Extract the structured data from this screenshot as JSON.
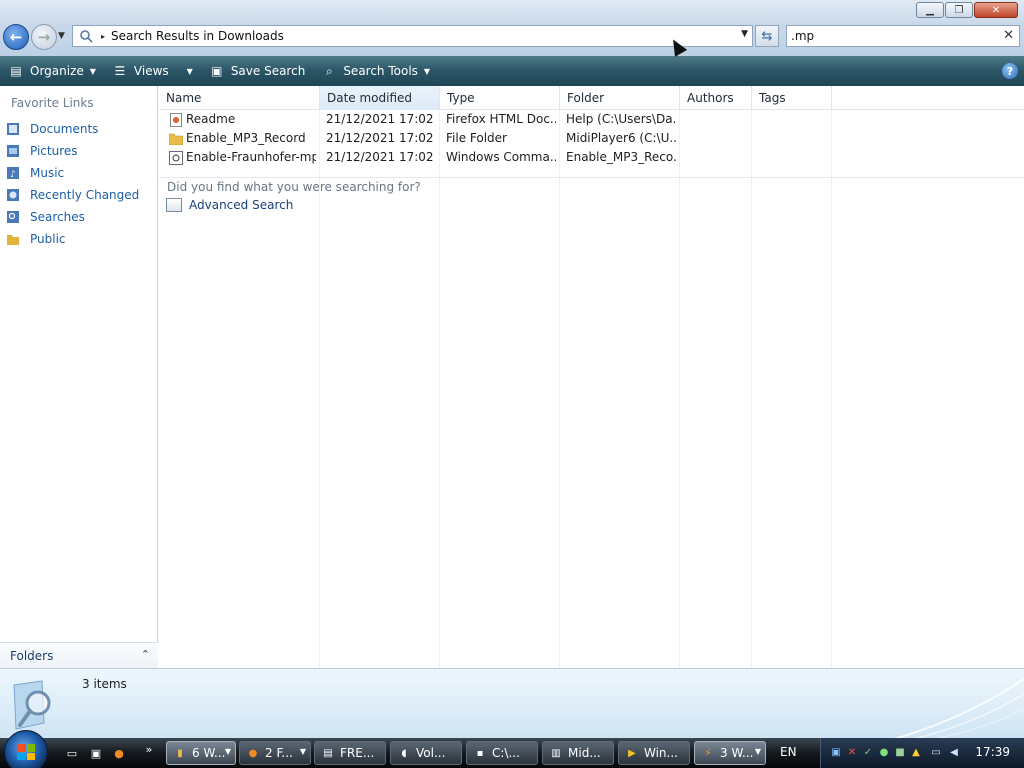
{
  "window": {
    "minimize_glyph": "▁",
    "maximize_glyph": "❐",
    "close_glyph": "✕"
  },
  "address_bar": {
    "path": "Search Results in Downloads",
    "separator": "▸",
    "icon": "search-folder-icon"
  },
  "search_box": {
    "value": ".mp",
    "clear_glyph": "✕"
  },
  "commandbar": {
    "organize_label": "Organize",
    "views_label": "Views",
    "save_search_label": "Save Search",
    "search_tools_label": "Search Tools"
  },
  "navpane": {
    "heading": "Favorite Links",
    "items": [
      {
        "label": "Documents",
        "icon": "documents-icon",
        "color": "#4a79b8"
      },
      {
        "label": "Pictures",
        "icon": "pictures-icon",
        "color": "#4a79b8"
      },
      {
        "label": "Music",
        "icon": "music-icon",
        "color": "#4a79b8"
      },
      {
        "label": "Recently Changed",
        "icon": "recently-changed-icon",
        "color": "#4a79b8"
      },
      {
        "label": "Searches",
        "icon": "searches-icon",
        "color": "#4a79b8"
      },
      {
        "label": "Public",
        "icon": "public-folder-icon",
        "color": "#e2b43b"
      }
    ],
    "folders_label": "Folders"
  },
  "filelist": {
    "columns": [
      "Name",
      "Date modified",
      "Type",
      "Folder",
      "Authors",
      "Tags"
    ],
    "rows": [
      {
        "name": "Readme",
        "date": "21/12/2021 17:02",
        "type": "Firefox HTML Doc...",
        "folder": "Help (C:\\Users\\Da...",
        "icon": "html-document-icon"
      },
      {
        "name": "Enable_MP3_Record",
        "date": "21/12/2021 17:02",
        "type": "File Folder",
        "folder": "MidiPlayer6 (C:\\U...",
        "icon": "folder-icon"
      },
      {
        "name": "Enable-Fraunhofer-mp...",
        "date": "21/12/2021 17:02",
        "type": "Windows Comma...",
        "folder": "Enable_MP3_Reco...",
        "icon": "command-script-icon"
      }
    ],
    "question": "Did you find what you were searching for?",
    "advanced_search": "Advanced Search"
  },
  "details": {
    "count_text": "3 items"
  },
  "taskbar": {
    "tasks": [
      {
        "label": "6 W...",
        "icon": "explorer-folder-icon"
      },
      {
        "label": "2 F...",
        "icon": "firefox-icon"
      },
      {
        "label": "FRE...",
        "icon": "notepad-icon"
      },
      {
        "label": "Vol...",
        "icon": "volume-icon"
      },
      {
        "label": "C:\\...",
        "icon": "command-prompt-icon"
      },
      {
        "label": "Mid...",
        "icon": "midi-player-icon"
      },
      {
        "label": "Win...",
        "icon": "media-player-icon"
      },
      {
        "label": "3 W...",
        "icon": "winamp-icon"
      }
    ],
    "language": "EN",
    "clock": "17:39"
  }
}
